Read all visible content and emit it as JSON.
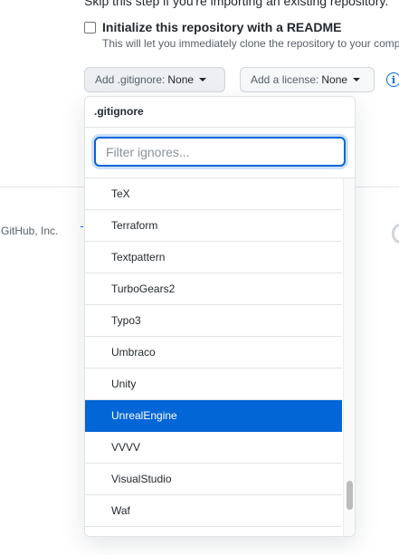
{
  "intro": {
    "skip_text": "Skip this step if you're importing an existing repository."
  },
  "readme": {
    "label": "Initialize this repository with a README",
    "description": "This will let you immediately clone the repository to your computer."
  },
  "gitignore_button": {
    "label": "Add .gitignore:",
    "value": "None"
  },
  "license_button": {
    "label": "Add a license:",
    "value": "None"
  },
  "footer": {
    "company": "GitHub, Inc."
  },
  "dropdown": {
    "header": ".gitignore",
    "filter_placeholder": "Filter ignores...",
    "items": [
      {
        "label": "TeX"
      },
      {
        "label": "Terraform"
      },
      {
        "label": "Textpattern"
      },
      {
        "label": "TurboGears2"
      },
      {
        "label": "Typo3"
      },
      {
        "label": "Umbraco"
      },
      {
        "label": "Unity"
      },
      {
        "label": "UnrealEngine",
        "selected": true
      },
      {
        "label": "VVVV"
      },
      {
        "label": "VisualStudio"
      },
      {
        "label": "Waf"
      }
    ],
    "scroll_position": 0.93
  },
  "colors": {
    "accent": "#0366d6",
    "border": "#e1e4e8",
    "text": "#24292e",
    "muted": "#586069"
  },
  "icons": {
    "info": "info-icon",
    "caret": "triangle-down-icon",
    "footer_logo": "github-mark-icon"
  }
}
